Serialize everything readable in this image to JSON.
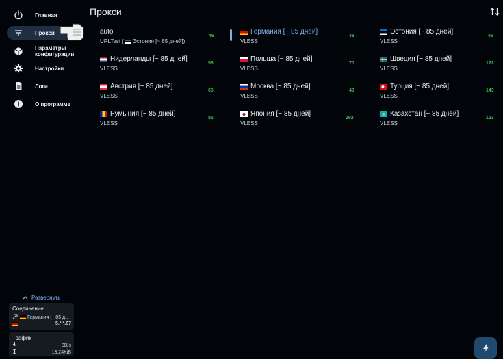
{
  "sidebar": {
    "items": [
      {
        "label": "Главная",
        "icon": "power-icon"
      },
      {
        "label": "Прокси",
        "icon": "filter-icon"
      },
      {
        "label": "Параметры\nконфигурации",
        "icon": "cube-icon"
      },
      {
        "label": "Настройки",
        "icon": "gear-icon"
      },
      {
        "label": "Логи",
        "icon": "document-icon"
      },
      {
        "label": "О программе",
        "icon": "info-icon"
      }
    ],
    "expand_label": "Развернуть",
    "connection": {
      "title": "Соединение",
      "proxy": "Германия [~ 85 д...",
      "ip": "5.*.*.67"
    },
    "traffic": {
      "title": "Трафик",
      "download": "0B/s",
      "total": "13.24KiB"
    }
  },
  "main": {
    "title": "Прокси",
    "proxies": [
      {
        "name": "auto",
        "type": "URLTest (",
        "type_extra": "Эстония [~ 85 дней])",
        "type_flag": "ee",
        "delay": "46",
        "flag": ""
      },
      {
        "name": "Германия [~ 85 дней]",
        "type": "VLESS",
        "delay": "48",
        "flag": "de",
        "selected": true
      },
      {
        "name": "Эстония [~ 85 дней]",
        "type": "VLESS",
        "delay": "46",
        "flag": "ee"
      },
      {
        "name": "Нидерланды [~ 85 дней]",
        "type": "VLESS",
        "delay": "58",
        "flag": "nl"
      },
      {
        "name": "Польша [~ 85 дней]",
        "type": "VLESS",
        "delay": "70",
        "flag": "pl"
      },
      {
        "name": "Швеция [~ 85 дней]",
        "type": "VLESS",
        "delay": "122",
        "flag": "se"
      },
      {
        "name": "Австрия [~ 85 дней]",
        "type": "VLESS",
        "delay": "65",
        "flag": "at"
      },
      {
        "name": "Москва [~ 85 дней]",
        "type": "VLESS",
        "delay": "49",
        "flag": "ru"
      },
      {
        "name": "Турция [~ 85 дней]",
        "type": "VLESS",
        "delay": "143",
        "flag": "tr"
      },
      {
        "name": "Румыния [~ 85 дней]",
        "type": "VLESS",
        "delay": "85",
        "flag": "ro"
      },
      {
        "name": "Япония [~ 85 дней]",
        "type": "VLESS",
        "delay": "292",
        "flag": "jp"
      },
      {
        "name": "Казахстан [~ 85 дней]",
        "type": "VLESS",
        "delay": "123",
        "flag": "kz"
      }
    ]
  },
  "colors": {
    "background": "#010409",
    "accent": "#7eb0e8",
    "delay_good": "#3fb950",
    "card": "#161b22"
  }
}
